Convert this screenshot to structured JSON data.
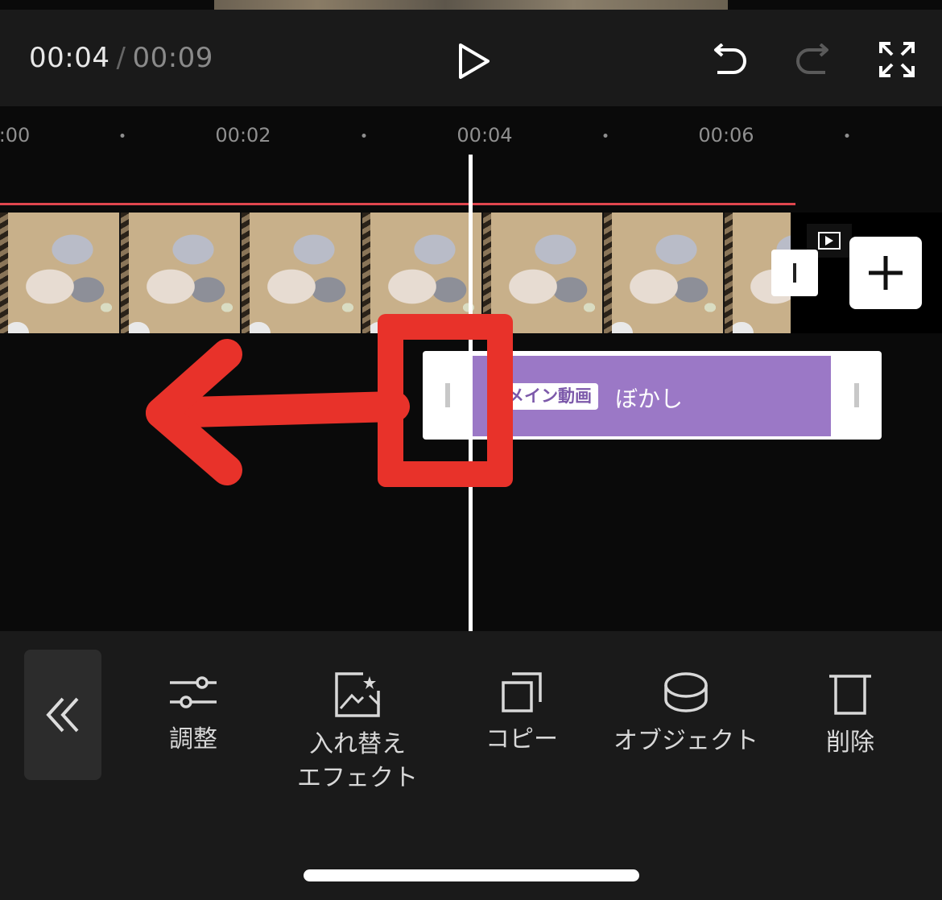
{
  "player": {
    "current_time": "00:04",
    "separator": "/",
    "total_time": "00:09"
  },
  "ruler": {
    "labels": [
      ":00",
      "00:02",
      "00:04",
      "00:06"
    ]
  },
  "effect_clip": {
    "tag": "メイン動画",
    "name": "ぼかし",
    "color": "#9b78c6"
  },
  "annotation": {
    "color": "#e8322a",
    "direction": "left"
  },
  "toolbar": {
    "items": [
      {
        "label": "調整",
        "icon": "sliders-icon"
      },
      {
        "label": "入れ替え",
        "label2": "エフェクト",
        "icon": "replace-effect-icon"
      },
      {
        "label": "コピー",
        "icon": "copy-icon"
      },
      {
        "label": "オブジェクト",
        "icon": "object-icon"
      },
      {
        "label": "削除",
        "icon": "trash-icon"
      }
    ]
  }
}
